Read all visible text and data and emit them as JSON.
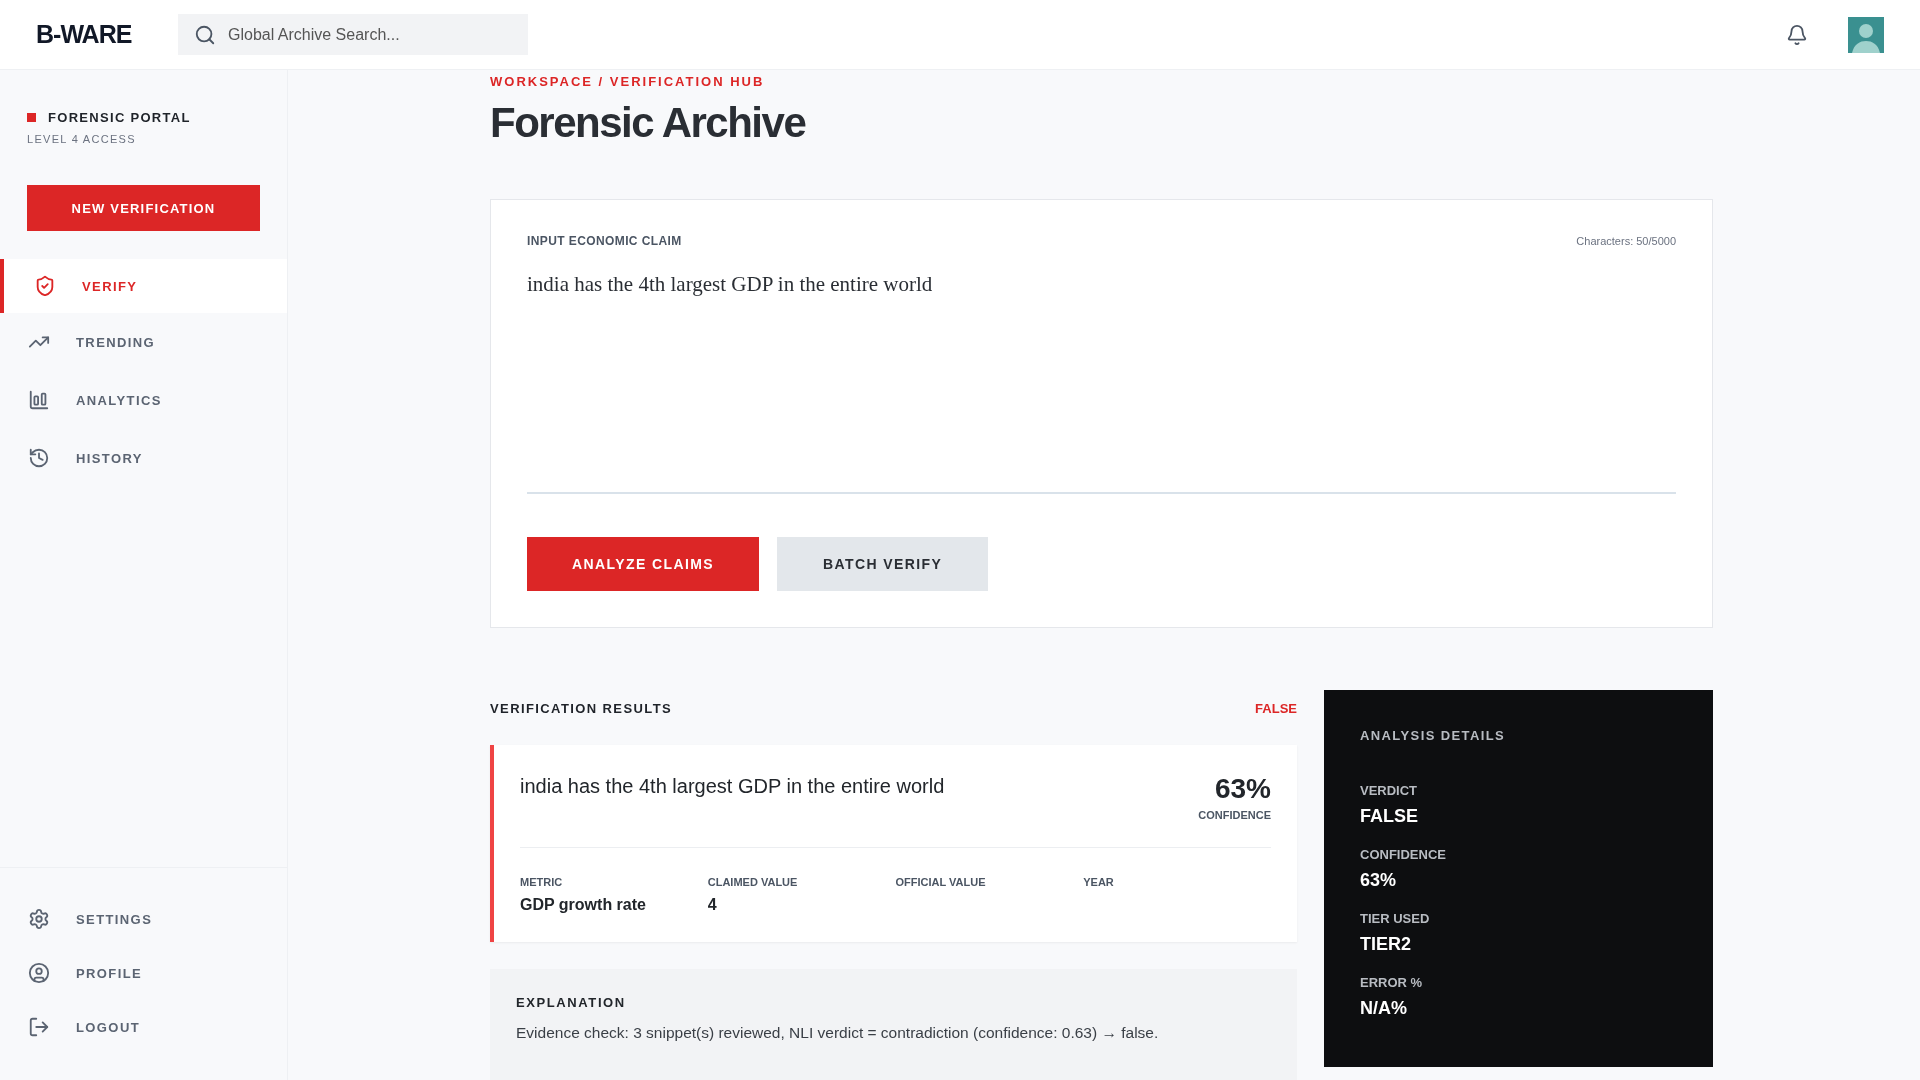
{
  "topbar": {
    "logo": "B-WARE",
    "search": {
      "placeholder": "Global Archive Search..."
    }
  },
  "sidebar": {
    "portal_title": "FORENSIC PORTAL",
    "portal_subtitle": "LEVEL 4 ACCESS",
    "new_button": "NEW VERIFICATION",
    "items": [
      {
        "label": "VERIFY",
        "selected": true
      },
      {
        "label": "TRENDING",
        "selected": false
      },
      {
        "label": "ANALYTICS",
        "selected": false
      },
      {
        "label": "HISTORY",
        "selected": false
      }
    ],
    "bottom_items": [
      {
        "label": "SETTINGS"
      },
      {
        "label": "PROFILE"
      },
      {
        "label": "LOGOUT"
      }
    ]
  },
  "breadcrumb": "WORKSPACE / VERIFICATION HUB",
  "title": "Forensic Archive",
  "input": {
    "label": "INPUT ECONOMIC CLAIM",
    "counter": "Characters: 50/5000",
    "value": "india has the 4th largest GDP in the entire world",
    "buttons": [
      {
        "label": "ANALYZE CLAIMS",
        "kind": "primary"
      },
      {
        "label": "BATCH VERIFY",
        "kind": "secondary"
      }
    ]
  },
  "results": {
    "heading": "VERIFICATION RESULTS",
    "verdict": "FALSE",
    "claim": "india has the 4th largest GDP in the entire world",
    "confidence": "63%",
    "confidence_label": "CONFIDENCE",
    "fields": [
      {
        "label": "METRIC",
        "value": "GDP growth rate"
      },
      {
        "label": "CLAIMED VALUE",
        "value": "4"
      },
      {
        "label": "OFFICIAL VALUE"
      },
      {
        "label": "YEAR"
      }
    ],
    "explanation_heading": "EXPLANATION",
    "explanation": "Evidence check: 3 snippet(s) reviewed, NLI verdict = contradiction (confidence: 0.63) → false."
  },
  "details": {
    "heading": "ANALYSIS DETAILS",
    "items": [
      {
        "label": "VERDICT",
        "value": "FALSE"
      },
      {
        "label": "CONFIDENCE",
        "value": "63%"
      },
      {
        "label": "TIER USED",
        "value": "TIER2"
      },
      {
        "label": "ERROR %",
        "value": "N/A%"
      }
    ]
  }
}
